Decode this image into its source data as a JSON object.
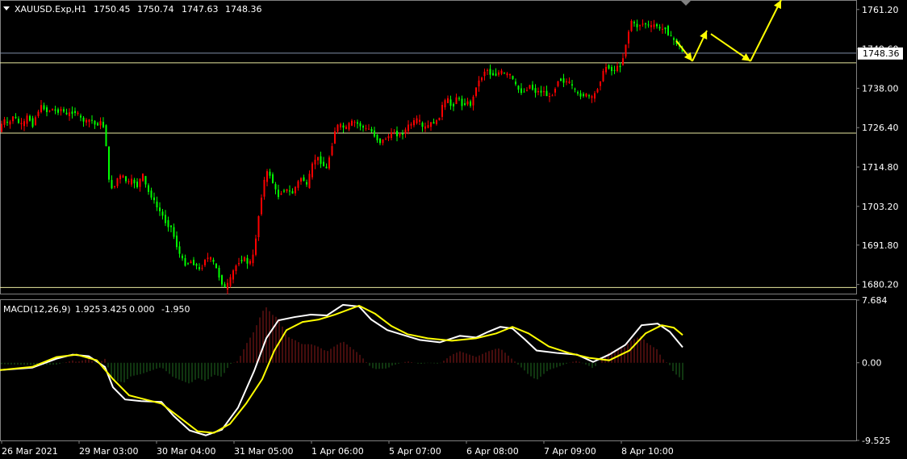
{
  "chart_data": [
    {
      "type": "candlestick",
      "symbol": "XAUUSD.Exp,H1",
      "ohlc_readout": [
        "1750.45",
        "1750.74",
        "1747.63",
        "1748.36"
      ],
      "current_price_label": "1748.36",
      "ylim": [
        1677.5,
        1764.0
      ],
      "y_ticks": [
        "1761.20",
        "1749.60",
        "1738.00",
        "1726.40",
        "1714.80",
        "1703.20",
        "1691.80",
        "1680.20"
      ],
      "x_ticks": [
        "26 Mar 2021",
        "29 Mar 03:00",
        "30 Mar 04:00",
        "31 Mar 05:00",
        "1 Apr 06:00",
        "5 Apr 07:00",
        "6 Apr 08:00",
        "7 Apr 09:00",
        "8 Apr 10:00"
      ],
      "horizontal_levels": [
        1748.36,
        1745.5,
        1724.8,
        1679.3
      ],
      "bullish_color": "#ff0000",
      "bearish_color": "#00ff00",
      "price_path": [
        [
          0,
          1725
        ],
        [
          6,
          1729
        ],
        [
          12,
          1727
        ],
        [
          18,
          1730
        ],
        [
          24,
          1728
        ],
        [
          30,
          1727
        ],
        [
          36,
          1730
        ],
        [
          42,
          1727
        ],
        [
          48,
          1731
        ],
        [
          54,
          1733
        ],
        [
          60,
          1731
        ],
        [
          66,
          1732
        ],
        [
          72,
          1731
        ],
        [
          78,
          1732
        ],
        [
          84,
          1730
        ],
        [
          90,
          1731
        ],
        [
          96,
          1731
        ],
        [
          102,
          1729
        ],
        [
          108,
          1728
        ],
        [
          114,
          1729
        ],
        [
          120,
          1727
        ],
        [
          126,
          1728
        ],
        [
          132,
          1726
        ],
        [
          136,
          1711
        ],
        [
          142,
          1708
        ],
        [
          148,
          1712
        ],
        [
          154,
          1712
        ],
        [
          160,
          1710
        ],
        [
          166,
          1711
        ],
        [
          172,
          1709
        ],
        [
          178,
          1713
        ],
        [
          184,
          1708
        ],
        [
          190,
          1706
        ],
        [
          196,
          1703
        ],
        [
          202,
          1701
        ],
        [
          208,
          1698
        ],
        [
          214,
          1697
        ],
        [
          220,
          1692
        ],
        [
          226,
          1688
        ],
        [
          232,
          1686
        ],
        [
          238,
          1687
        ],
        [
          244,
          1686
        ],
        [
          250,
          1684
        ],
        [
          256,
          1688
        ],
        [
          262,
          1688
        ],
        [
          268,
          1686
        ],
        [
          274,
          1682
        ],
        [
          280,
          1679
        ],
        [
          286,
          1681
        ],
        [
          292,
          1685
        ],
        [
          298,
          1687
        ],
        [
          304,
          1688
        ],
        [
          310,
          1686
        ],
        [
          316,
          1689
        ],
        [
          322,
          1700
        ],
        [
          328,
          1710
        ],
        [
          334,
          1714
        ],
        [
          340,
          1710
        ],
        [
          346,
          1706
        ],
        [
          352,
          1708
        ],
        [
          358,
          1708
        ],
        [
          364,
          1707
        ],
        [
          370,
          1710
        ],
        [
          376,
          1712
        ],
        [
          382,
          1709
        ],
        [
          388,
          1715
        ],
        [
          394,
          1718
        ],
        [
          400,
          1716
        ],
        [
          406,
          1714
        ],
        [
          412,
          1720
        ],
        [
          418,
          1727
        ],
        [
          424,
          1727
        ],
        [
          430,
          1726
        ],
        [
          436,
          1728
        ],
        [
          442,
          1728
        ],
        [
          448,
          1727
        ],
        [
          454,
          1726
        ],
        [
          460,
          1726
        ],
        [
          466,
          1724
        ],
        [
          472,
          1722
        ],
        [
          478,
          1723
        ],
        [
          484,
          1724
        ],
        [
          490,
          1725
        ],
        [
          496,
          1724
        ],
        [
          502,
          1725
        ],
        [
          508,
          1727
        ],
        [
          514,
          1728
        ],
        [
          520,
          1729
        ],
        [
          526,
          1726
        ],
        [
          532,
          1727
        ],
        [
          538,
          1728
        ],
        [
          544,
          1728
        ],
        [
          550,
          1733
        ],
        [
          556,
          1735
        ],
        [
          562,
          1732
        ],
        [
          568,
          1736
        ],
        [
          574,
          1733
        ],
        [
          580,
          1734
        ],
        [
          586,
          1733
        ],
        [
          592,
          1739
        ],
        [
          598,
          1741
        ],
        [
          604,
          1744
        ],
        [
          610,
          1742
        ],
        [
          616,
          1742
        ],
        [
          622,
          1743
        ],
        [
          628,
          1742
        ],
        [
          634,
          1742
        ],
        [
          640,
          1739
        ],
        [
          646,
          1737
        ],
        [
          652,
          1737
        ],
        [
          658,
          1739
        ],
        [
          664,
          1737
        ],
        [
          670,
          1737
        ],
        [
          676,
          1737
        ],
        [
          682,
          1735
        ],
        [
          688,
          1737
        ],
        [
          694,
          1741
        ],
        [
          700,
          1740
        ],
        [
          706,
          1740
        ],
        [
          712,
          1738
        ],
        [
          718,
          1736
        ],
        [
          724,
          1736
        ],
        [
          730,
          1736
        ],
        [
          736,
          1735
        ],
        [
          742,
          1738
        ],
        [
          748,
          1742
        ],
        [
          754,
          1745
        ],
        [
          760,
          1743
        ],
        [
          766,
          1744
        ],
        [
          772,
          1745
        ],
        [
          778,
          1752
        ],
        [
          784,
          1758
        ],
        [
          790,
          1756
        ],
        [
          796,
          1757
        ],
        [
          802,
          1757
        ],
        [
          808,
          1756
        ],
        [
          814,
          1757
        ],
        [
          820,
          1755
        ],
        [
          826,
          1756
        ],
        [
          832,
          1753
        ],
        [
          838,
          1752
        ],
        [
          844,
          1750
        ],
        [
          848,
          1748.4
        ]
      ],
      "forecast_arrows": [
        [
          [
            838,
            1752
          ],
          [
            858,
            1746
          ]
        ],
        [
          [
            858,
            1746
          ],
          [
            876,
            1755
          ]
        ],
        [
          [
            881,
            1754
          ],
          [
            930,
            1746
          ]
        ],
        [
          [
            930,
            1746
          ],
          [
            968,
            1764
          ]
        ]
      ],
      "forecast_color": "#ffff00"
    },
    {
      "type": "line",
      "indicator": "MACD(12,26,9)",
      "readout": [
        "1.925",
        "3.425",
        "0.000",
        "-1.950"
      ],
      "ylim": [
        -9.525,
        7.684
      ],
      "y_ticks": [
        "7.684",
        "0.00",
        "-9.525"
      ],
      "series": [
        {
          "role": "main",
          "color": "#ffffff",
          "points": [
            [
              0,
              -0.9
            ],
            [
              40,
              -0.6
            ],
            [
              70,
              0.5
            ],
            [
              90,
              1.0
            ],
            [
              110,
              0.8
            ],
            [
              130,
              -0.5
            ],
            [
              140,
              -3.0
            ],
            [
              155,
              -4.5
            ],
            [
              175,
              -4.7
            ],
            [
              200,
              -4.8
            ],
            [
              215,
              -6.5
            ],
            [
              235,
              -8.3
            ],
            [
              255,
              -8.9
            ],
            [
              275,
              -8.2
            ],
            [
              295,
              -5.5
            ],
            [
              315,
              -1.0
            ],
            [
              330,
              3.0
            ],
            [
              345,
              5.2
            ],
            [
              365,
              5.6
            ],
            [
              385,
              5.9
            ],
            [
              405,
              5.8
            ],
            [
              425,
              7.1
            ],
            [
              445,
              6.9
            ],
            [
              460,
              5.3
            ],
            [
              480,
              4.0
            ],
            [
              500,
              3.4
            ],
            [
              520,
              2.8
            ],
            [
              545,
              2.5
            ],
            [
              570,
              3.3
            ],
            [
              590,
              3.1
            ],
            [
              605,
              3.8
            ],
            [
              620,
              4.4
            ],
            [
              635,
              4.2
            ],
            [
              650,
              2.9
            ],
            [
              665,
              1.5
            ],
            [
              690,
              1.2
            ],
            [
              715,
              1.0
            ],
            [
              735,
              0.1
            ],
            [
              755,
              1.0
            ],
            [
              775,
              2.2
            ],
            [
              795,
              4.6
            ],
            [
              815,
              4.8
            ],
            [
              830,
              3.8
            ],
            [
              846,
              1.9
            ]
          ]
        },
        {
          "role": "signal",
          "color": "#ffff00",
          "points": [
            [
              0,
              -0.9
            ],
            [
              40,
              -0.5
            ],
            [
              70,
              0.7
            ],
            [
              95,
              1.0
            ],
            [
              120,
              0.3
            ],
            [
              140,
              -2.0
            ],
            [
              160,
              -4.0
            ],
            [
              180,
              -4.5
            ],
            [
              200,
              -5.0
            ],
            [
              220,
              -6.5
            ],
            [
              245,
              -8.4
            ],
            [
              265,
              -8.6
            ],
            [
              285,
              -7.5
            ],
            [
              305,
              -5.0
            ],
            [
              325,
              -2.0
            ],
            [
              340,
              1.5
            ],
            [
              355,
              4.0
            ],
            [
              375,
              5.0
            ],
            [
              395,
              5.3
            ],
            [
              415,
              5.9
            ],
            [
              445,
              7.0
            ],
            [
              465,
              6.0
            ],
            [
              485,
              4.5
            ],
            [
              505,
              3.5
            ],
            [
              530,
              3.0
            ],
            [
              560,
              2.7
            ],
            [
              590,
              3.0
            ],
            [
              615,
              3.6
            ],
            [
              635,
              4.4
            ],
            [
              655,
              3.6
            ],
            [
              680,
              2.0
            ],
            [
              705,
              1.2
            ],
            [
              730,
              0.6
            ],
            [
              755,
              0.3
            ],
            [
              780,
              1.5
            ],
            [
              800,
              3.6
            ],
            [
              820,
              4.6
            ],
            [
              835,
              4.3
            ],
            [
              846,
              3.4
            ]
          ]
        }
      ],
      "histogram_positive_color": "#8b1a1a",
      "histogram_negative_color": "#1f6b1f"
    }
  ]
}
